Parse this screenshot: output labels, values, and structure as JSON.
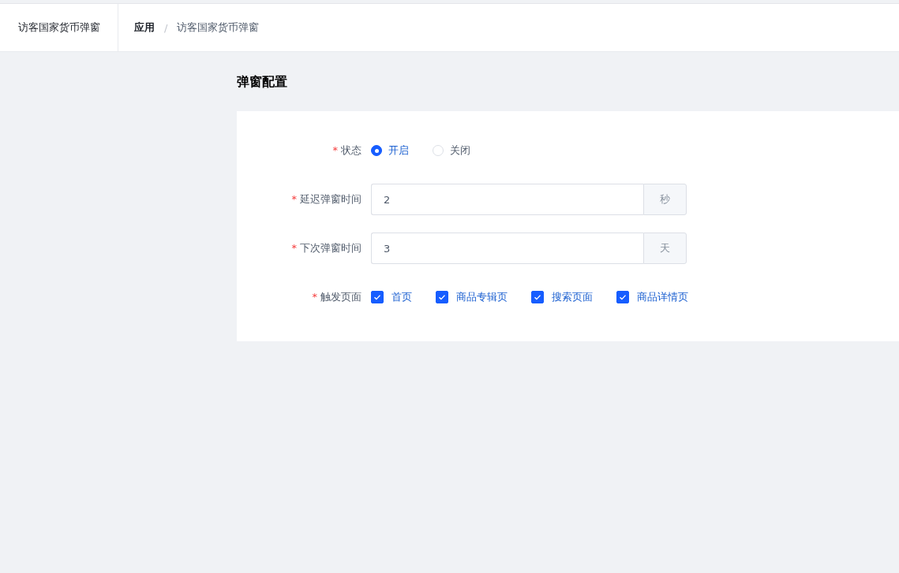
{
  "header": {
    "app_title": "访客国家货币弹窗",
    "breadcrumb": [
      {
        "label": "应用",
        "current": false
      },
      {
        "label": "访客国家货币弹窗",
        "current": true
      }
    ],
    "separator": "/"
  },
  "section_title": "弹窗配置",
  "form": [
    {
      "kind": "radio",
      "required_mark": "*",
      "label": "状态",
      "options": [
        {
          "label": "开启",
          "selected": true
        },
        {
          "label": "关闭",
          "selected": false
        }
      ]
    },
    {
      "kind": "input",
      "required_mark": "*",
      "label": "延迟弹窗时间",
      "value": "2",
      "suffix": "秒"
    },
    {
      "kind": "input",
      "required_mark": "*",
      "label": "下次弹窗时间",
      "value": "3",
      "suffix": "天"
    },
    {
      "kind": "checkbox",
      "required_mark": "*",
      "label": "触发页面",
      "options": [
        {
          "label": "首页",
          "checked": true
        },
        {
          "label": "商品专辑页",
          "checked": true
        },
        {
          "label": "搜索页面",
          "checked": true
        },
        {
          "label": "商品详情页",
          "checked": true
        }
      ]
    }
  ]
}
